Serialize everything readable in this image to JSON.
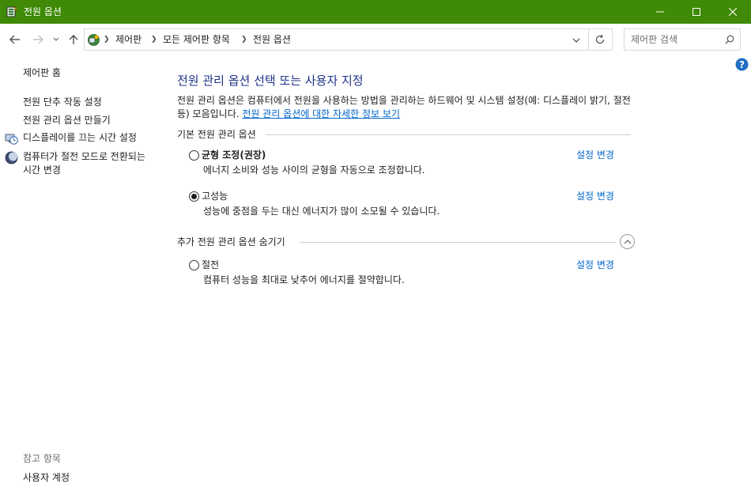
{
  "window": {
    "title": "전원 옵션",
    "buttons": {
      "minimize": "minimize",
      "maximize": "maximize",
      "close": "close"
    }
  },
  "address": {
    "crumbs": [
      "제어판",
      "모든 제어판 항목",
      "전원 옵션"
    ]
  },
  "search": {
    "placeholder": "제어판 검색"
  },
  "left_pane": {
    "home": "제어판 홈",
    "links": [
      {
        "label": "전원 단추 작동 설정",
        "icon": null
      },
      {
        "label": "전원 관리 옵션 만들기",
        "icon": null
      },
      {
        "label": "디스플레이를 끄는 시간 설정",
        "icon": "display-clock-icon"
      },
      {
        "label": "컴퓨터가 절전 모드로 전환되는 시간 변경",
        "icon": "moon-sleep-icon"
      }
    ],
    "see_also": "참고 항목",
    "user_accounts": "사용자 계정"
  },
  "main": {
    "title": "전원 관리 옵션 선택 또는 사용자 지정",
    "description": "전원 관리 옵션은 컴퓨터에서 전원을 사용하는 방법을 관리하는 하드웨어 및 시스템 설정(예: 디스플레이 밝기, 절전 등) 모음입니다.",
    "description_link": "전원 관리 옵션에 대한 자세한 정보 보기",
    "basic_group": "기본 전원 관리 옵션",
    "extra_group": "추가 전원 관리 옵션 숨기기",
    "change_label": "설정 변경",
    "plans": [
      {
        "name": "균형 조정(권장)",
        "desc": "에너지 소비와 성능 사이의 균형을 자동으로 조정합니다.",
        "selected": false,
        "bold": true
      },
      {
        "name": "고성능",
        "desc": "성능에 중점을 두는 대신 에너지가 많이 소모될 수 있습니다.",
        "selected": true,
        "bold": false
      },
      {
        "name": "절전",
        "desc": "컴퓨터 성능을 최대로 낮추어 에너지를 절약합니다.",
        "selected": false,
        "bold": false
      }
    ]
  },
  "colors": {
    "titlebar": "#3f8a06",
    "heading": "#1e3287",
    "link": "#0066cc"
  }
}
